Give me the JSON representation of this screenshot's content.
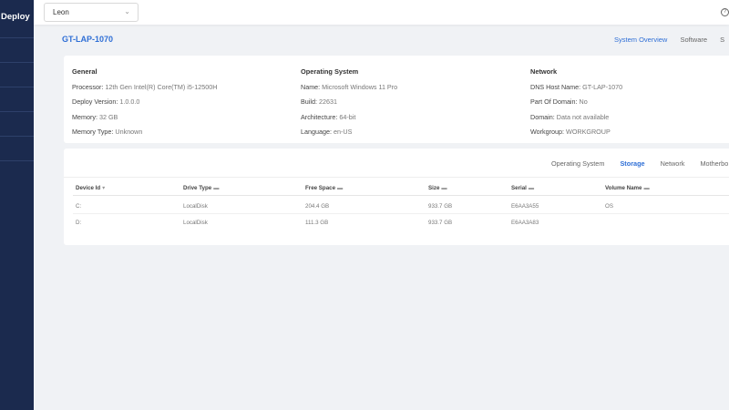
{
  "sidebar": {
    "brand": "Deploy"
  },
  "topbar": {
    "user": "Leon"
  },
  "device": {
    "title": "GT-LAP-1070",
    "tabs": [
      "System Overview",
      "Software",
      "S"
    ]
  },
  "general": {
    "heading": "General",
    "rows": [
      {
        "label": "Processor:",
        "value": "12th Gen Intel(R) Core(TM) i5-12500H"
      },
      {
        "label": "Deploy Version:",
        "value": "1.0.0.0"
      },
      {
        "label": "Memory:",
        "value": "32 GB"
      },
      {
        "label": "Memory Type:",
        "value": "Unknown"
      }
    ]
  },
  "os": {
    "heading": "Operating System",
    "rows": [
      {
        "label": "Name:",
        "value": "Microsoft Windows 11 Pro"
      },
      {
        "label": "Build:",
        "value": "22631"
      },
      {
        "label": "Architecture:",
        "value": "64-bit"
      },
      {
        "label": "Language:",
        "value": "en-US"
      }
    ]
  },
  "network": {
    "heading": "Network",
    "rows": [
      {
        "label": "DNS Host Name:",
        "value": "GT-LAP-1070"
      },
      {
        "label": "Part Of Domain:",
        "value": "No"
      },
      {
        "label": "Domain:",
        "value": "Data not available"
      },
      {
        "label": "Workgroup:",
        "value": "WORKGROUP"
      }
    ]
  },
  "storage": {
    "tabs": [
      "Operating System",
      "Storage",
      "Network",
      "Motherbo"
    ],
    "columns": [
      "Device Id",
      "Drive Type",
      "Free Space",
      "Size",
      "Serial",
      "Volume Name"
    ],
    "rows": [
      [
        "C:",
        "LocalDisk",
        "204.4 GB",
        "933.7 GB",
        "E6AA3A55",
        "OS"
      ],
      [
        "D:",
        "LocalDisk",
        "111.3 GB",
        "933.7 GB",
        "E6AA3A83",
        ""
      ]
    ]
  }
}
